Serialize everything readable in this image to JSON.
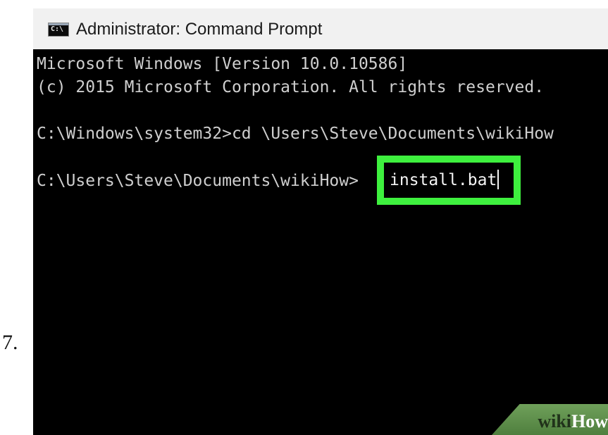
{
  "step": {
    "number": "7."
  },
  "window": {
    "title": "Administrator: Command Prompt",
    "icon": {
      "name": "cmd-icon",
      "glyph": "C:\\"
    }
  },
  "console": {
    "lines": [
      "Microsoft Windows [Version 10.0.10586]",
      "(c) 2015 Microsoft Corporation. All rights reserved.",
      "C:\\Windows\\system32>cd \\Users\\Steve\\Documents\\wikiHow",
      "C:\\Users\\Steve\\Documents\\wikiHow>"
    ],
    "typed_command": "install.bat"
  },
  "highlight": {
    "color": "#3ef03e"
  },
  "watermark": {
    "part1": "wiki",
    "part2": "How",
    "color": "#5a8a45"
  }
}
